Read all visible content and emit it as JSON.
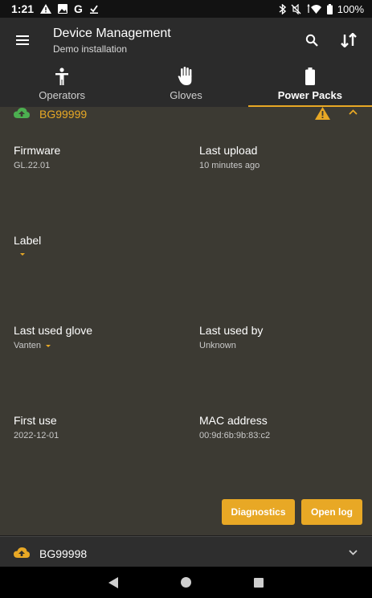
{
  "status_bar": {
    "time": "1:21",
    "battery": "100%",
    "left_glyph_g": "G"
  },
  "app_bar": {
    "title": "Device Management",
    "subtitle": "Demo installation"
  },
  "tabs": [
    {
      "label": "Operators",
      "icon": "person-icon"
    },
    {
      "label": "Gloves",
      "icon": "glove-icon"
    },
    {
      "label": "Power Packs",
      "icon": "battery-icon",
      "active": true
    }
  ],
  "expanded_pack": {
    "id": "BG99999",
    "warning_icon": "warning-icon",
    "firmware_label": "Firmware",
    "firmware_value": "GL.22.01",
    "last_upload_label": "Last upload",
    "last_upload_value": "10 minutes ago",
    "label_label": "Label",
    "last_glove_label": "Last used glove",
    "last_glove_value": "Vanten",
    "last_used_by_label": "Last used by",
    "last_used_by_value": "Unknown",
    "first_use_label": "First use",
    "first_use_value": "2022-12-01",
    "mac_label": "MAC address",
    "mac_value": "00:9d:6b:9b:83:c2",
    "diagnostics_label": "Diagnostics",
    "open_log_label": "Open log"
  },
  "collapsed_pack": {
    "id": "BG99998"
  },
  "colors": {
    "accent": "#e8a825",
    "panel": "#3c3a33",
    "bar": "#2b2b2b",
    "upload_green": "#4caf50",
    "upload_orange": "#e8a825"
  }
}
